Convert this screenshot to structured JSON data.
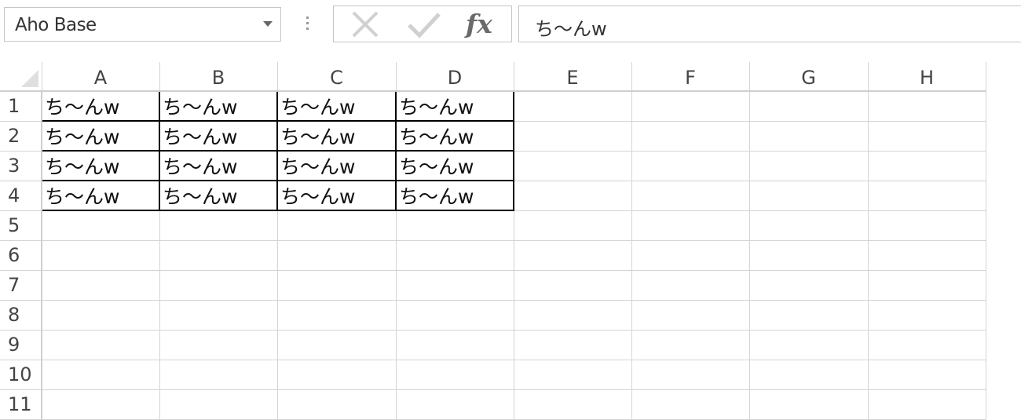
{
  "name_box": {
    "value": "Aho Base",
    "dropdown_icon": "chevron-down-icon"
  },
  "formula_bar": {
    "cancel_icon": "close-icon",
    "enter_icon": "check-icon",
    "function_label": "fx",
    "value": "ち～んw"
  },
  "sheet": {
    "columns": [
      "A",
      "B",
      "C",
      "D",
      "E",
      "F",
      "G",
      "H"
    ],
    "rows": [
      "1",
      "2",
      "3",
      "4",
      "5",
      "6",
      "7",
      "8",
      "9",
      "10",
      "11"
    ],
    "cells": [
      [
        "ち～んw",
        "ち～んw",
        "ち～んw",
        "ち～んw",
        "",
        "",
        "",
        ""
      ],
      [
        "ち～んw",
        "ち～んw",
        "ち～んw",
        "ち～んw",
        "",
        "",
        "",
        ""
      ],
      [
        "ち～んw",
        "ち～んw",
        "ち～んw",
        "ち～んw",
        "",
        "",
        "",
        ""
      ],
      [
        "ち～んw",
        "ち～んw",
        "ち～んw",
        "ち～んw",
        "",
        "",
        "",
        ""
      ],
      [
        "",
        "",
        "",
        "",
        "",
        "",
        "",
        ""
      ],
      [
        "",
        "",
        "",
        "",
        "",
        "",
        "",
        ""
      ],
      [
        "",
        "",
        "",
        "",
        "",
        "",
        "",
        ""
      ],
      [
        "",
        "",
        "",
        "",
        "",
        "",
        "",
        ""
      ],
      [
        "",
        "",
        "",
        "",
        "",
        "",
        "",
        ""
      ],
      [
        "",
        "",
        "",
        "",
        "",
        "",
        "",
        ""
      ],
      [
        "",
        "",
        "",
        "",
        "",
        "",
        "",
        ""
      ]
    ]
  }
}
